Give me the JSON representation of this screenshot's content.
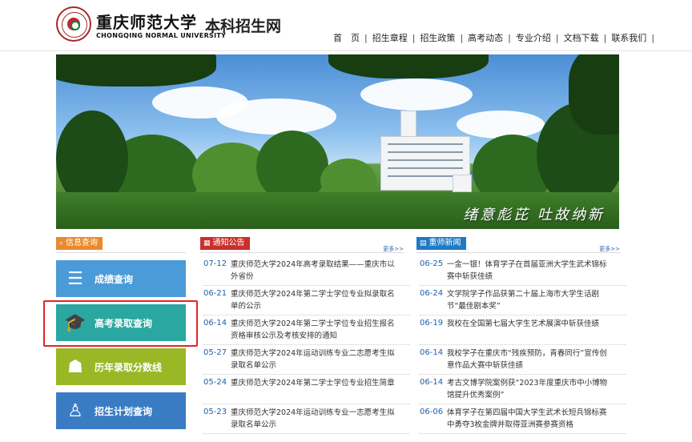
{
  "header": {
    "uni_name_cn": "重庆师范大学",
    "uni_name_en": "CHONGQING NORMAL UNIVERSITY",
    "site_title": "本科招生网",
    "nav": [
      "首　页",
      "招生章程",
      "招生政策",
      "高考动态",
      "专业介绍",
      "文档下载",
      "联系我们"
    ]
  },
  "banner": {
    "calligraphy": "绪意彪芘  吐故纳新"
  },
  "query": {
    "title": "信息查询",
    "buttons": [
      "成绩查询",
      "高考录取查询",
      "历年录取分数线",
      "招生计划查询"
    ]
  },
  "notice": {
    "title": "通知公告",
    "more": "更多>>",
    "items": [
      {
        "date": "07-12",
        "text": "重庆师范大学2024年高考录取结果——重庆市以外省份"
      },
      {
        "date": "06-21",
        "text": "重庆师范大学2024年第二学士学位专业拟录取名单的公示"
      },
      {
        "date": "06-14",
        "text": "重庆师范大学2024年第二学士学位专业招生报名资格审核公示及考核安排的通知"
      },
      {
        "date": "05-27",
        "text": "重庆师范大学2024年运动训练专业二志愿考生拟录取名单公示"
      },
      {
        "date": "05-24",
        "text": "重庆师范大学2024年第二学士学位专业招生简章"
      },
      {
        "date": "05-23",
        "text": "重庆师范大学2024年运动训练专业一志愿考生拟录取名单公示"
      }
    ]
  },
  "news": {
    "title": "重师新闻",
    "more": "更多>>",
    "items": [
      {
        "date": "06-25",
        "text": "一金一银！体育学子在首届亚洲大学生武术锦标赛中斩获佳绩"
      },
      {
        "date": "06-24",
        "text": "文学院学子作品获第二十届上海市大学生话剧节“最佳剧本奖”"
      },
      {
        "date": "06-19",
        "text": "我校在全国第七届大学生艺术展演中斩获佳绩"
      },
      {
        "date": "06-14",
        "text": "我校学子在重庆市“残疾预防，青春同行”宣传创意作品大赛中斩获佳绩"
      },
      {
        "date": "06-14",
        "text": "考古文博学院案例获“2023年度重庆市中小博物馆提升优秀案例”"
      },
      {
        "date": "06-06",
        "text": "体育学子在第四届中国大学生武术长短兵锦标赛中勇夺3枚金牌并取得亚洲赛参赛资格"
      }
    ]
  }
}
